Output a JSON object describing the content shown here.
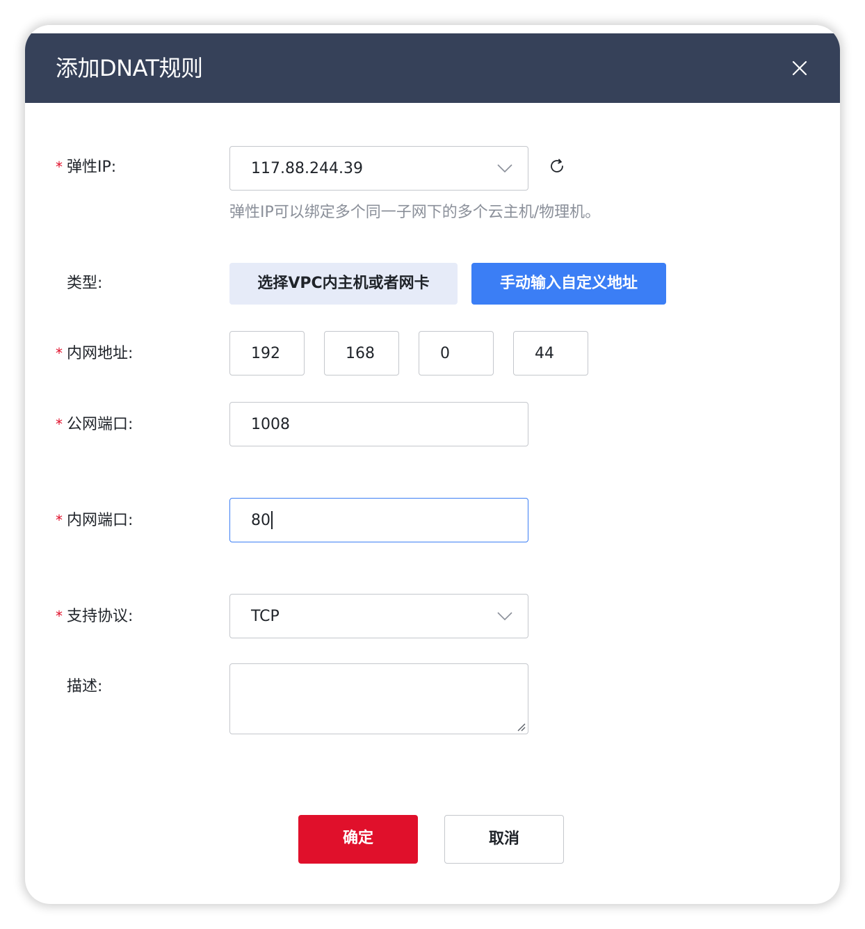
{
  "dialog": {
    "title": "添加DNAT规则",
    "close_icon": "close-icon"
  },
  "colors": {
    "header_bg": "#364159",
    "primary": "#3b7ef5",
    "danger": "#e0102b",
    "required_star": "#e0102b"
  },
  "form": {
    "required_mark": "*",
    "elastic_ip": {
      "label": "弹性IP:",
      "value": "117.88.244.39",
      "hint": "弹性IP可以绑定多个同一子网下的多个云主机/物理机。",
      "refresh_icon": "refresh-icon"
    },
    "type": {
      "label": "类型:",
      "options": [
        "选择VPC内主机或者网卡",
        "手动输入自定义地址"
      ],
      "selected": "手动输入自定义地址"
    },
    "private_address": {
      "label": "内网地址:",
      "octets": [
        "192",
        "168",
        "0",
        "44"
      ]
    },
    "public_port": {
      "label": "公网端口:",
      "value": "1008"
    },
    "private_port": {
      "label": "内网端口:",
      "value": "80"
    },
    "protocol": {
      "label": "支持协议:",
      "value": "TCP"
    },
    "description": {
      "label": "描述:",
      "value": ""
    }
  },
  "footer": {
    "confirm_label": "确定",
    "cancel_label": "取消"
  }
}
